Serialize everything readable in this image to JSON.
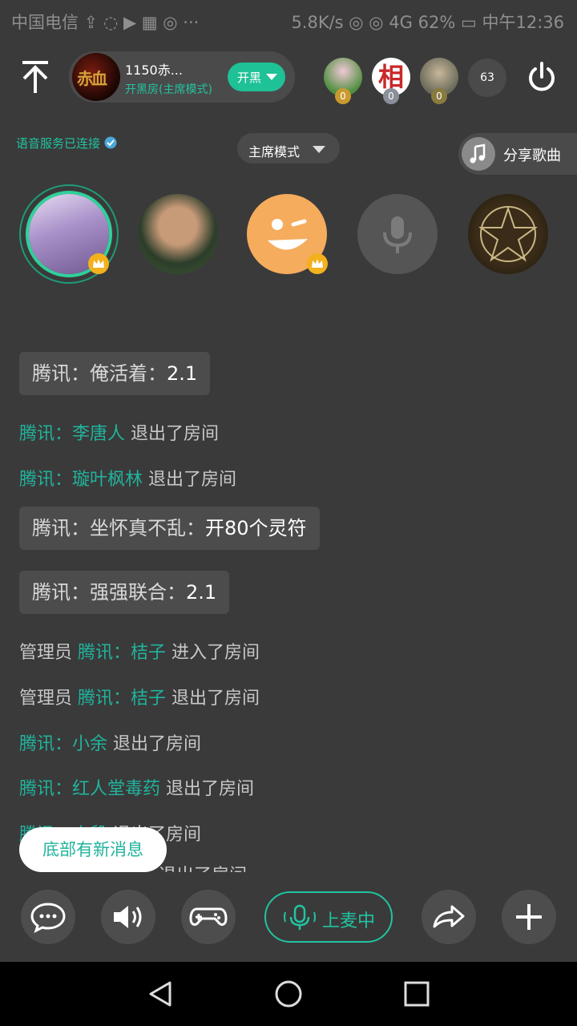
{
  "status_bar": {
    "left": "中国电信 ⇪ ◌ ▶ ▦ ◎ ···",
    "right": "5.8K/s ◎ ◎ 4G 62% ▭ 中午12:36"
  },
  "header": {
    "room_name": "1150赤...",
    "room_subtitle": "开黑房(主席模式)",
    "mode_button_label": "开黑",
    "room_avatar_text": "赤血",
    "audience_badges": [
      "0",
      "0",
      "0"
    ],
    "audience_avatar_2_text": "相",
    "online_count": "63"
  },
  "row2": {
    "voice_status": "语音服务已连接",
    "mode_label": "主席模式",
    "share_label": "分享歌曲"
  },
  "messages": [
    {
      "type": "bubble",
      "prefix": "腾讯：俺活着：",
      "value": "2.1"
    },
    {
      "type": "line",
      "name": "腾讯：李唐人",
      "action": "退出了房间"
    },
    {
      "type": "line",
      "name": "腾讯：璇叶枫林",
      "action": "退出了房间"
    },
    {
      "type": "bubble",
      "prefix": "腾讯：坐怀真不乱：",
      "value": "开80个灵符"
    },
    {
      "type": "bubble",
      "prefix": "腾讯：强强联合：",
      "value": "2.1"
    },
    {
      "type": "line",
      "role": "管理员",
      "name": "腾讯：桔子",
      "action": "进入了房间"
    },
    {
      "type": "line",
      "role": "管理员",
      "name": "腾讯：桔子",
      "action": "退出了房间"
    },
    {
      "type": "line",
      "name": "腾讯：小余",
      "action": "退出了房间"
    },
    {
      "type": "line",
      "name": "腾讯：红人堂毒药",
      "action": "退出了房间"
    },
    {
      "type": "line",
      "name": "腾讯：小段",
      "action": "退出了房间"
    },
    {
      "type": "line",
      "name": "",
      "action": "退出了房间"
    }
  ],
  "new_message_toast": "底部有新消息",
  "bottom_bar": {
    "mic_label": "上麦中"
  },
  "colors": {
    "background": "#3a3a3a",
    "accent": "#1fc196",
    "crown": "#f2b11d"
  }
}
